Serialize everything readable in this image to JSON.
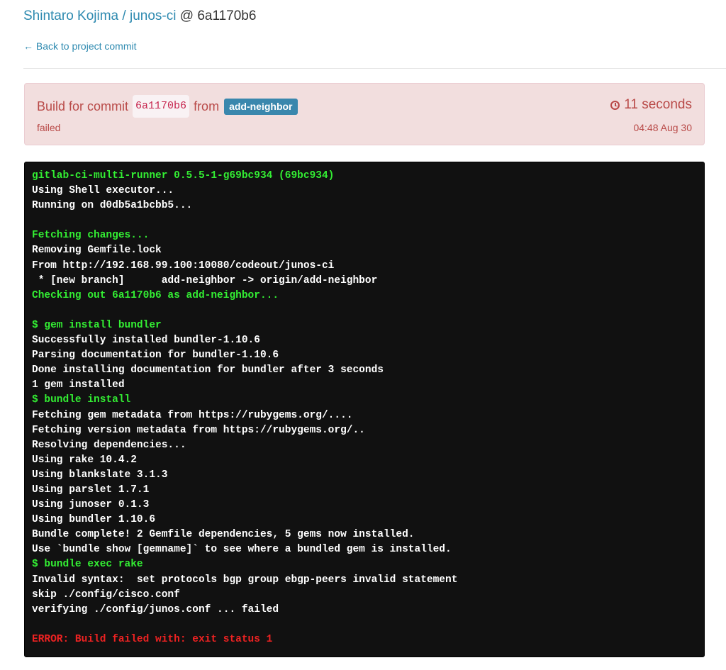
{
  "header": {
    "owner": "Shintaro Kojima",
    "separator": "/",
    "project": "junos-ci",
    "at": "@",
    "commit_sha": "6a1170b6"
  },
  "back_link": "← Back to project commit",
  "build": {
    "prefix": "Build for commit",
    "sha": "6a1170b6",
    "from": "from",
    "branch": "add-neighbor",
    "status": "failed",
    "duration": "11 seconds",
    "finished_at": "04:48 Aug 30"
  },
  "colors": {
    "link": "#2e8ab0",
    "alert_bg": "#f2dede",
    "alert_text": "#b94a48",
    "branch_label": "#3a87ad",
    "terminal_bg": "#111111",
    "terminal_green": "#33ee33",
    "terminal_red": "#ee2222"
  },
  "trace": [
    {
      "text": "gitlab-ci-multi-runner 0.5.5-1-g69bc934 (69bc934)",
      "style": "green"
    },
    {
      "text": "Using Shell executor...",
      "style": "white"
    },
    {
      "text": "Running on d0db5a1bcbb5...",
      "style": "white"
    },
    {
      "text": "",
      "style": "white"
    },
    {
      "text": "Fetching changes...",
      "style": "green"
    },
    {
      "text": "Removing Gemfile.lock",
      "style": "white"
    },
    {
      "text": "From http://192.168.99.100:10080/codeout/junos-ci",
      "style": "white"
    },
    {
      "text": " * [new branch]      add-neighbor -> origin/add-neighbor",
      "style": "white"
    },
    {
      "text": "Checking out 6a1170b6 as add-neighbor...",
      "style": "green"
    },
    {
      "text": "",
      "style": "white"
    },
    {
      "text": "$ gem install bundler",
      "style": "green"
    },
    {
      "text": "Successfully installed bundler-1.10.6",
      "style": "white"
    },
    {
      "text": "Parsing documentation for bundler-1.10.6",
      "style": "white"
    },
    {
      "text": "Done installing documentation for bundler after 3 seconds",
      "style": "white"
    },
    {
      "text": "1 gem installed",
      "style": "white"
    },
    {
      "text": "$ bundle install",
      "style": "green"
    },
    {
      "text": "Fetching gem metadata from https://rubygems.org/....",
      "style": "white"
    },
    {
      "text": "Fetching version metadata from https://rubygems.org/..",
      "style": "white"
    },
    {
      "text": "Resolving dependencies...",
      "style": "white"
    },
    {
      "text": "Using rake 10.4.2",
      "style": "white"
    },
    {
      "text": "Using blankslate 3.1.3",
      "style": "white"
    },
    {
      "text": "Using parslet 1.7.1",
      "style": "white"
    },
    {
      "text": "Using junoser 0.1.3",
      "style": "white"
    },
    {
      "text": "Using bundler 1.10.6",
      "style": "white"
    },
    {
      "text": "Bundle complete! 2 Gemfile dependencies, 5 gems now installed.",
      "style": "white"
    },
    {
      "text": "Use `bundle show [gemname]` to see where a bundled gem is installed.",
      "style": "white"
    },
    {
      "text": "$ bundle exec rake",
      "style": "green"
    },
    {
      "text": "Invalid syntax:  set protocols bgp group ebgp-peers invalid statement",
      "style": "white"
    },
    {
      "text": "skip ./config/cisco.conf",
      "style": "white"
    },
    {
      "text": "verifying ./config/junos.conf ... failed",
      "style": "white"
    },
    {
      "text": "",
      "style": "white"
    },
    {
      "text": "ERROR: Build failed with: exit status 1",
      "style": "red"
    }
  ]
}
